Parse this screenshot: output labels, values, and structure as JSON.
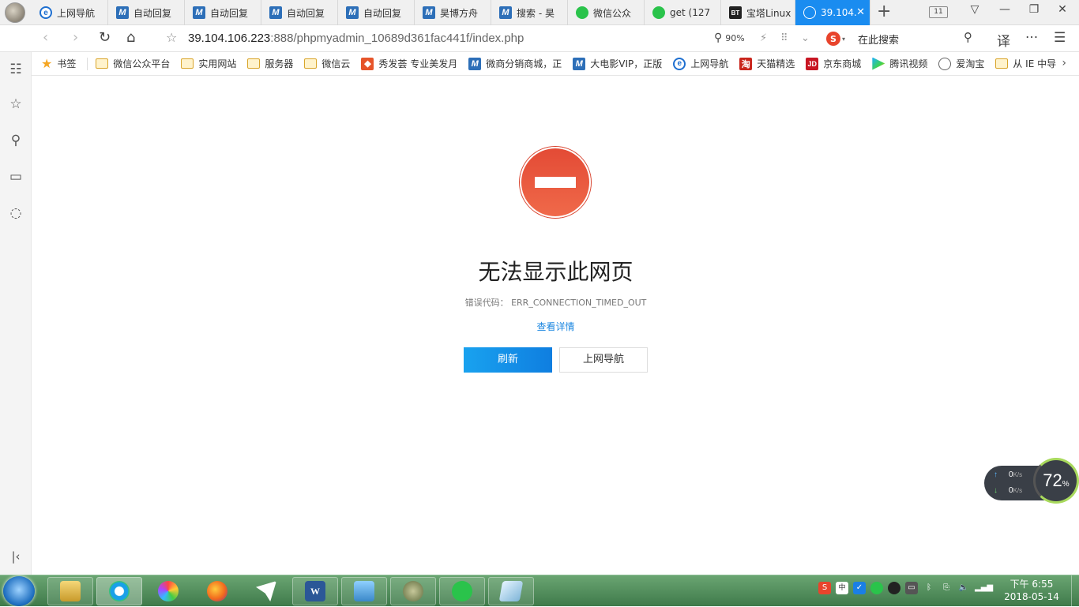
{
  "tabs": [
    {
      "label": "上网导航",
      "icon": "ie-icon"
    },
    {
      "label": "自动回复",
      "icon": "m-icon"
    },
    {
      "label": "自动回复",
      "icon": "m-icon"
    },
    {
      "label": "自动回复",
      "icon": "m-icon"
    },
    {
      "label": "自动回复",
      "icon": "m-icon"
    },
    {
      "label": "昊博方舟",
      "icon": "m-icon"
    },
    {
      "label": "搜索 - 昊",
      "icon": "m-icon"
    },
    {
      "label": "微信公众",
      "icon": "wechat-icon"
    },
    {
      "label": "get (127",
      "icon": "wechat-icon"
    },
    {
      "label": "宝塔Linux",
      "icon": "bt-icon"
    },
    {
      "label": "39.104.",
      "icon": "globe-icon",
      "active": true
    }
  ],
  "tab_count": "11",
  "address": {
    "host": "39.104.106.223",
    "path": ":888/phpmyadmin_10689d361fac441f/index.php"
  },
  "zoom": "90%",
  "search": {
    "placeholder": "在此搜索"
  },
  "toolbar": {
    "translate_label": "译",
    "more_label": "···"
  },
  "bookmarks": [
    {
      "label": "书签",
      "icon": "star-icon"
    },
    {
      "label": "微信公众平台",
      "icon": "folder-icon"
    },
    {
      "label": "实用网站",
      "icon": "folder-icon"
    },
    {
      "label": "服务器",
      "icon": "folder-icon"
    },
    {
      "label": "微信云",
      "icon": "folder-icon"
    },
    {
      "label": "秀发荟 专业美发月",
      "icon": "magento-icon"
    },
    {
      "label": "微商分销商城，正",
      "icon": "m-icon"
    },
    {
      "label": "大电影VIP，正版",
      "icon": "m-icon"
    },
    {
      "label": "上网导航",
      "icon": "ie-icon"
    },
    {
      "label": "天猫精选",
      "icon": "tmall-icon"
    },
    {
      "label": "京东商城",
      "icon": "jd-icon"
    },
    {
      "label": "腾讯视频",
      "icon": "tencent-video-icon"
    },
    {
      "label": "爱淘宝",
      "icon": "globe-icon"
    },
    {
      "label": "从 IE 中导",
      "icon": "folder-icon"
    }
  ],
  "error": {
    "title": "无法显示此网页",
    "code_label": "错误代码：",
    "code": "ERR_CONNECTION_TIMED_OUT",
    "details_link": "查看详情",
    "refresh_button": "刷新",
    "nav_button": "上网导航"
  },
  "net_widget": {
    "up": "0",
    "down": "0",
    "unit": "K/s",
    "percent": "72",
    "percent_sign": "%"
  },
  "clock": {
    "time": "下午 6:55",
    "date": "2018-05-14"
  },
  "colors": {
    "accent": "#1a8cf0",
    "error_red": "#e34a35",
    "link": "#1a86e0"
  }
}
